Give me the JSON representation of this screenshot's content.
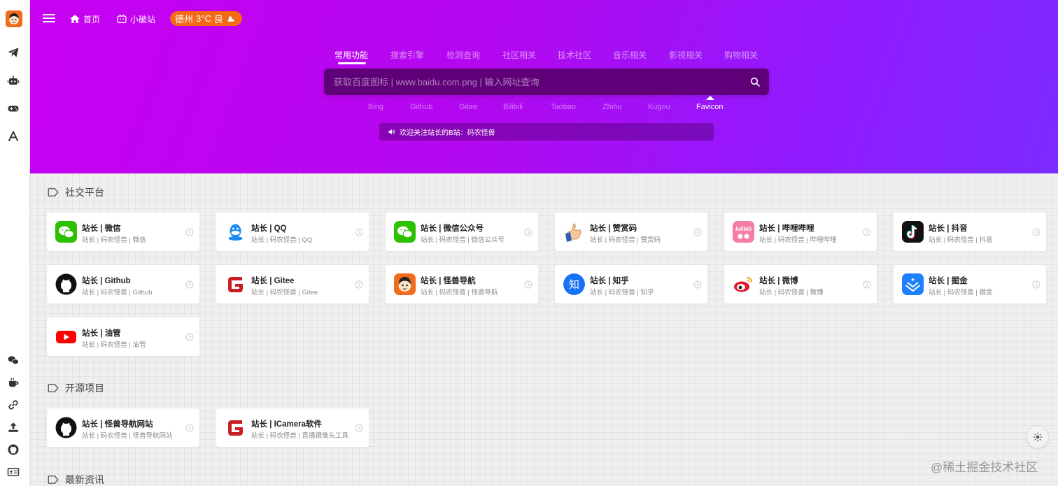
{
  "topbar": {
    "home_label": "首页",
    "bilibili_label": "小破站",
    "weather_city": "德州",
    "weather_temp": "3°C",
    "weather_quality": "良"
  },
  "search": {
    "tabs": [
      "常用功能",
      "搜索引擎",
      "检测查询",
      "社区相关",
      "技术社区",
      "音乐相关",
      "影视相关",
      "购物相关"
    ],
    "active_tab": "常用功能",
    "placeholder": "获取百度图标 | www.baidu.com.png | 输入网址查询",
    "engines": [
      "Bing",
      "Github",
      "Gitee",
      "Bilibili",
      "Taobao",
      "Zhihu",
      "Kugou",
      "Favicon"
    ],
    "active_engine": "Favicon"
  },
  "notice": {
    "text": "欢迎关注站长的B站：码农怪兽"
  },
  "sections": [
    {
      "title": "社交平台",
      "cards": [
        {
          "title": "站长 | 微信",
          "desc": "站长 | 码农怪兽 | 微信",
          "icon": "wechat-icon"
        },
        {
          "title": "站长 | QQ",
          "desc": "站长 | 码农怪兽 | QQ",
          "icon": "qq-icon"
        },
        {
          "title": "站长 | 微信公众号",
          "desc": "站长 | 码农怪兽 | 微信公众号",
          "icon": "wechat-icon"
        },
        {
          "title": "站长 | 赞赏码",
          "desc": "站长 | 码农怪兽 | 赞赏码",
          "icon": "thumbs-up-icon"
        },
        {
          "title": "站长 | 哔哩哔哩",
          "desc": "站长 | 码农怪兽 | 哔哩哔哩",
          "icon": "bilibili-icon"
        },
        {
          "title": "站长 | 抖音",
          "desc": "站长 | 码农怪兽 | 抖音",
          "icon": "douyin-icon"
        },
        {
          "title": "站长 | Github",
          "desc": "站长 | 码农怪兽 | Github",
          "icon": "github-icon"
        },
        {
          "title": "站长 | Gitee",
          "desc": "站长 | 码农怪兽 | Gitee",
          "icon": "gitee-icon"
        },
        {
          "title": "站长 | 怪兽导航",
          "desc": "站长 | 码农怪兽 | 怪兽导航",
          "icon": "avatar-icon"
        },
        {
          "title": "站长 | 知乎",
          "desc": "站长 | 码农怪兽 | 知乎",
          "icon": "zhihu-icon"
        },
        {
          "title": "站长 | 微博",
          "desc": "站长 | 码农怪兽 | 微博",
          "icon": "weibo-icon"
        },
        {
          "title": "站长 | 掘金",
          "desc": "站长 | 码农怪兽 | 掘金",
          "icon": "juejin-icon"
        },
        {
          "title": "站长 | 油管",
          "desc": "站长 | 码农怪兽 | 油管",
          "icon": "youtube-icon"
        }
      ]
    },
    {
      "title": "开源项目",
      "cards": [
        {
          "title": "站长 | 怪兽导航网站",
          "desc": "站长 | 码农怪兽 | 怪兽导航网站",
          "icon": "github-icon"
        },
        {
          "title": "站长 | ICamera软件",
          "desc": "站长 | 码农怪兽 | 直播摄像头工具",
          "icon": "gitee-icon"
        }
      ]
    },
    {
      "title": "最新资讯",
      "cards": []
    }
  ],
  "watermark": "@稀土掘金技术社区",
  "colors": {
    "hero_start": "#c800f2",
    "hero_end": "#7c2cff",
    "weather_badge": "#f46a17",
    "search_bg": "#5f0078"
  }
}
